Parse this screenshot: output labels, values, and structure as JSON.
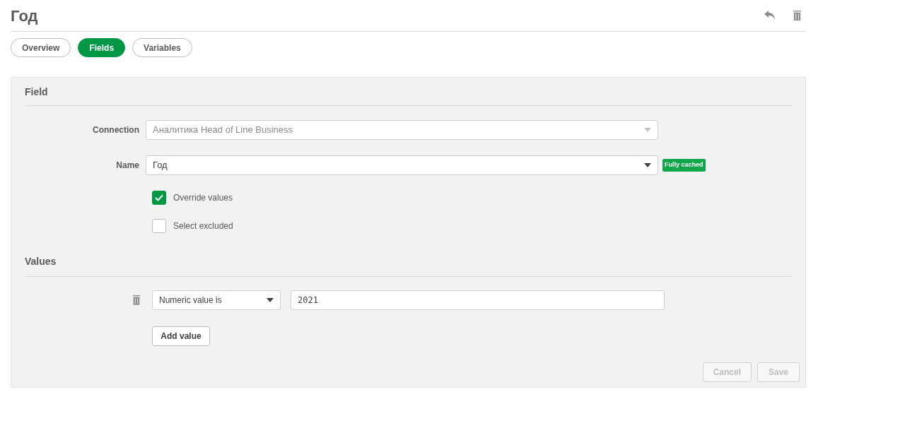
{
  "title": "Год",
  "tabs": [
    {
      "label": "Overview",
      "selected": false
    },
    {
      "label": "Fields",
      "selected": true
    },
    {
      "label": "Variables",
      "selected": false
    }
  ],
  "field_section": {
    "heading": "Field",
    "connection": {
      "label": "Connection",
      "value": "Аналитика Head of Line Business",
      "disabled": true
    },
    "name": {
      "label": "Name",
      "value": "Год",
      "disabled": false,
      "badge": "Fully cached"
    },
    "checkboxes": [
      {
        "label": "Override values",
        "checked": true
      },
      {
        "label": "Select excluded",
        "checked": false
      }
    ]
  },
  "values_section": {
    "heading": "Values",
    "rows": [
      {
        "condition": "Numeric value is",
        "value": "2021"
      }
    ],
    "add_button": "Add value"
  },
  "footer_buttons": [
    {
      "label": "Cancel",
      "disabled": true
    },
    {
      "label": "Save",
      "disabled": true
    }
  ]
}
